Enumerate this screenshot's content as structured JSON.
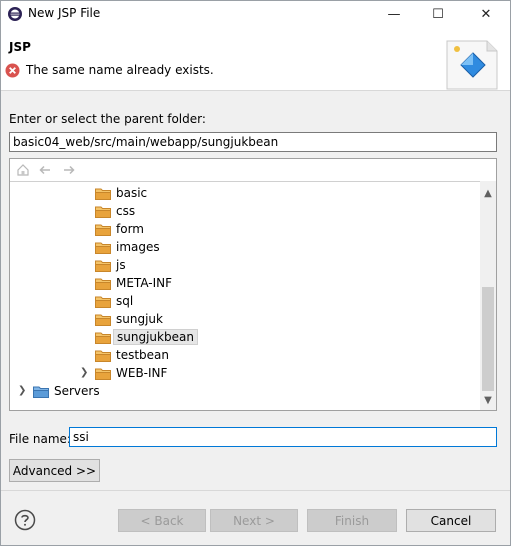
{
  "window": {
    "title": "New JSP File",
    "minimize_glyph": "—",
    "maximize_glyph": "☐",
    "close_glyph": "✕"
  },
  "header": {
    "title": "JSP",
    "error_message": "The same name already exists."
  },
  "parent_folder": {
    "label": "Enter or select the parent folder:",
    "value": "basic04_web/src/main/webapp/sungjukbean"
  },
  "tree": {
    "items": [
      {
        "label": "basic",
        "expandable": false,
        "selected": false
      },
      {
        "label": "css",
        "expandable": false,
        "selected": false
      },
      {
        "label": "form",
        "expandable": false,
        "selected": false
      },
      {
        "label": "images",
        "expandable": false,
        "selected": false
      },
      {
        "label": "js",
        "expandable": false,
        "selected": false
      },
      {
        "label": "META-INF",
        "expandable": false,
        "selected": false
      },
      {
        "label": "sql",
        "expandable": false,
        "selected": false
      },
      {
        "label": "sungjuk",
        "expandable": false,
        "selected": false
      },
      {
        "label": "sungjukbean",
        "expandable": false,
        "selected": true
      },
      {
        "label": "testbean",
        "expandable": false,
        "selected": false
      },
      {
        "label": "WEB-INF",
        "expandable": true,
        "selected": false
      },
      {
        "label": "Servers",
        "expandable": true,
        "selected": false
      }
    ]
  },
  "file_name": {
    "label": "File name:",
    "value": "ssi"
  },
  "buttons": {
    "advanced": "Advanced >>",
    "back": "< Back",
    "next": "Next >",
    "finish": "Finish",
    "cancel": "Cancel"
  },
  "icons": {
    "app": "eclipse-icon",
    "error": "error-icon",
    "wizard": "jsp-wizard-icon",
    "home": "home-icon",
    "back": "back-arrow-icon",
    "forward": "forward-arrow-icon",
    "folder": "folder-icon",
    "help": "help-icon"
  },
  "colors": {
    "error_red": "#d9534f",
    "focus_blue": "#0078d7",
    "folder_orange": "#e8a33c"
  }
}
